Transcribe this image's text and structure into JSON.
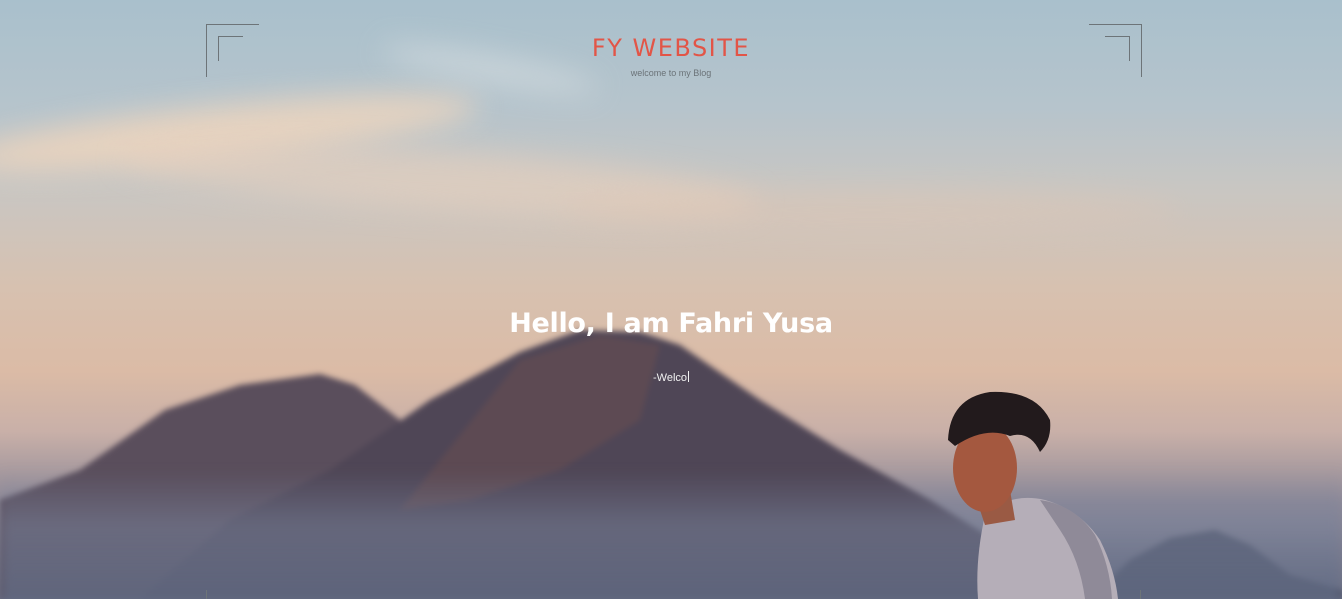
{
  "header": {
    "title": "FY WEBSITE",
    "tagline": "welcome to my Blog"
  },
  "hero": {
    "heading": "Hello, I am Fahri Yusa",
    "typed_text": "-Welco"
  },
  "colors": {
    "brand": "#e25547",
    "heading": "#ffffff",
    "frame_lines": "#6d7478"
  }
}
